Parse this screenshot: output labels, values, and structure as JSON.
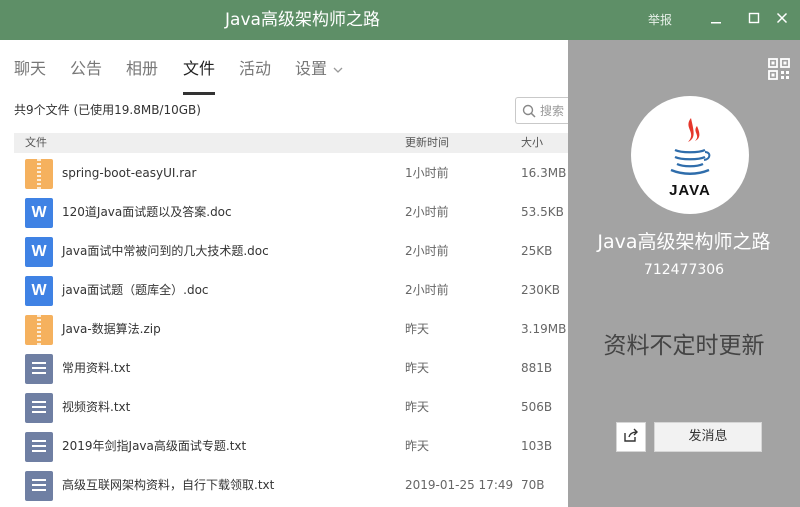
{
  "window": {
    "title": "Java高级架构师之路",
    "report_label": "举报",
    "minimize": "－",
    "maximize": "□",
    "close": "✕"
  },
  "tabs": [
    {
      "label": "聊天"
    },
    {
      "label": "公告"
    },
    {
      "label": "相册"
    },
    {
      "label": "文件",
      "active": true
    },
    {
      "label": "活动"
    },
    {
      "label": "设置"
    }
  ],
  "summary": "共9个文件 (已使用19.8MB/10GB)",
  "search": {
    "placeholder": "搜索"
  },
  "columns": {
    "name": "文件",
    "time": "更新时间",
    "size": "大小"
  },
  "files": [
    {
      "name": "spring-boot-easyUI.rar",
      "time": "1小时前",
      "size": "16.3MB",
      "icon": "archive-icon"
    },
    {
      "name": "120道Java面试题以及答案.doc",
      "time": "2小时前",
      "size": "53.5KB",
      "icon": "word-doc-icon"
    },
    {
      "name": "Java面试中常被问到的几大技术题.doc",
      "time": "2小时前",
      "size": "25KB",
      "icon": "word-doc-icon"
    },
    {
      "name": "java面试题（题库全）.doc",
      "time": "2小时前",
      "size": "230KB",
      "icon": "word-doc-icon"
    },
    {
      "name": "Java-数据算法.zip",
      "time": "昨天",
      "size": "3.19MB",
      "icon": "archive-icon"
    },
    {
      "name": "常用资料.txt",
      "time": "昨天",
      "size": "881B",
      "icon": "text-file-icon"
    },
    {
      "name": "视频资料.txt",
      "time": "昨天",
      "size": "506B",
      "icon": "text-file-icon"
    },
    {
      "name": "2019年剑指Java高级面试专题.txt",
      "time": "昨天",
      "size": "103B",
      "icon": "text-file-icon"
    },
    {
      "name": "高级互联网架构资料，自行下载领取.txt",
      "time": "2019-01-25 17:49",
      "size": "70B",
      "icon": "text-file-icon"
    }
  ],
  "side": {
    "avatar_text": "JAVA",
    "group_name": "Java高级架构师之路",
    "group_id": "712477306",
    "notice": "资料不定时更新",
    "send_message": "发消息"
  },
  "colors": {
    "titlebar": "#5e8f67",
    "side_panel": "#a3a3a3",
    "zip": "#f5b15e",
    "doc": "#3f82e4",
    "txt": "#6f7fa3"
  }
}
